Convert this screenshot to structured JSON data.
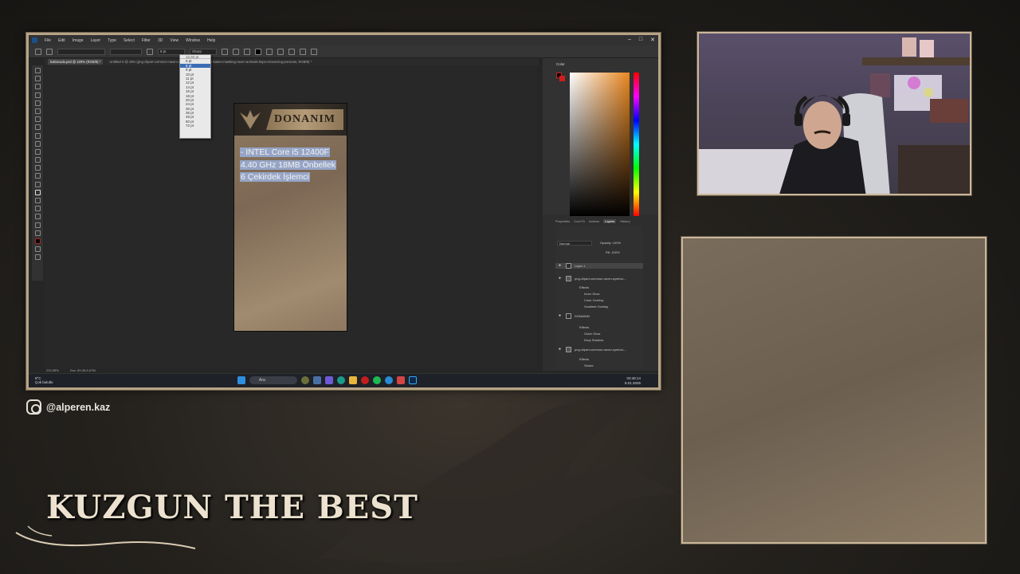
{
  "photoshop": {
    "menu": [
      "File",
      "Edit",
      "Image",
      "Layer",
      "Type",
      "Select",
      "Filter",
      "3D",
      "View",
      "Window",
      "Help"
    ],
    "options": {
      "font_family": "",
      "font_size": "8 pt",
      "antialias": "Sharp"
    },
    "tabs": [
      "kuklavuda.psd @ 229% (RGB/8) *",
      "Untitled-4 @ 16% (png-clipart-common-raven-common-...)",
      "...naan-kasen-masking-raven-animals-kopo-renamving-previous, RGB/8) *"
    ],
    "size_dropdown": {
      "top": "12,92 pt",
      "options": [
        "6 pt",
        "8 pt",
        "9 pt",
        "10 pt",
        "11 pt",
        "12 pt",
        "14 pt",
        "16 pt",
        "18 pt",
        "20 pt",
        "24 pt",
        "30 pt",
        "36 pt",
        "48 pt",
        "60 pt",
        "72 pt"
      ],
      "selected": "8 pt"
    },
    "card": {
      "title": "DONANIM",
      "lines": [
        "- INTEL Core i5 12400F",
        "4.40 GHz 18MB Önbellek",
        "6 Çekirdek İşlemci"
      ]
    },
    "status": {
      "zoom": "229,38%",
      "doc": "Doc: 89,3K/1,67M"
    },
    "color_panel": {
      "title": "Color"
    },
    "layers_tabs": [
      "Properties",
      "Cool Fx",
      "Actions",
      "Layers",
      "History"
    ],
    "layers_tab_active": "Layers",
    "blend_mode": "Normal",
    "opacity": "Opacity: 100%",
    "fill": "Fill: 100%",
    "layers": [
      {
        "name": "Layer 1",
        "kind": "text",
        "indent": 0
      },
      {
        "name": "png-clipart-common-raven-symbol-...",
        "kind": "image",
        "indent": 0
      },
      {
        "name": "Effects",
        "kind": "fx",
        "indent": 1
      },
      {
        "name": "Inner Glow",
        "kind": "fx",
        "indent": 2
      },
      {
        "name": "Color Overlay",
        "kind": "fx",
        "indent": 2
      },
      {
        "name": "Gradient Overlay",
        "kind": "fx",
        "indent": 2
      },
      {
        "name": "DONANIM",
        "kind": "text",
        "indent": 0
      },
      {
        "name": "Effects",
        "kind": "fx",
        "indent": 1
      },
      {
        "name": "Outer Glow",
        "kind": "fx",
        "indent": 2
      },
      {
        "name": "Drop Shadow",
        "kind": "fx",
        "indent": 2
      },
      {
        "name": "png-clipart-common-raven-symbol-...",
        "kind": "image",
        "indent": 0
      },
      {
        "name": "Effects",
        "kind": "fx",
        "indent": 1
      },
      {
        "name": "Stroke",
        "kind": "fx",
        "indent": 2
      }
    ]
  },
  "taskbar": {
    "weather_temp": "8°C",
    "weather_desc": "Çok bulutlu",
    "search": "Ara",
    "time": "03:46:14",
    "date": "8.01.2026"
  },
  "overlay": {
    "instagram": "@alperen.kaz",
    "brand": "KUZGUN THE BEST"
  }
}
